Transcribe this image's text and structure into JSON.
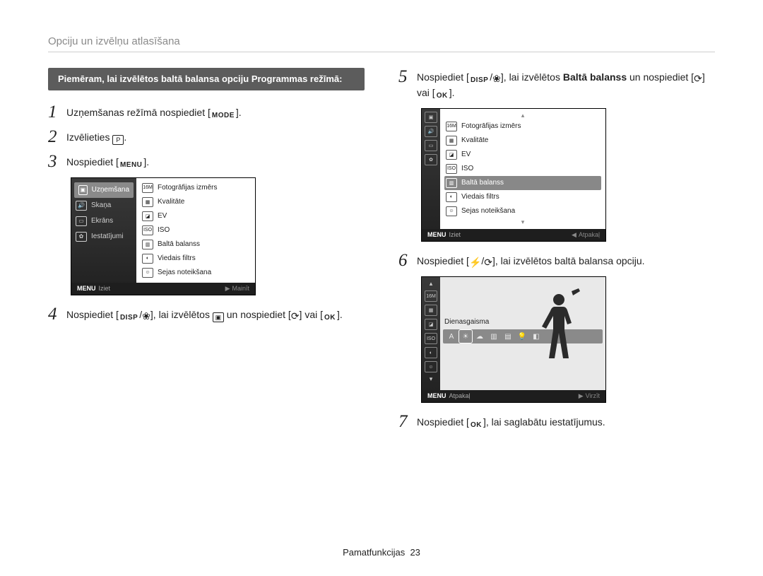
{
  "page_title": "Opciju un izvēlņu atlasīšana",
  "banner": "Piemēram, lai izvēlētos baltā balansa opciju Programmas režīmā:",
  "buttons": {
    "mode": "MODE",
    "menu": "MENU",
    "disp": "DISP",
    "ok": "OK"
  },
  "step_count": 7,
  "steps": {
    "s1": {
      "pre": "Uzņemšanas režīmā nospiediet [",
      "post": "]."
    },
    "s2": {
      "pre": "Izvēlieties ",
      "post": "."
    },
    "s3": {
      "pre": "Nospiediet [",
      "post": "]."
    },
    "s4": {
      "a": "Nospiediet [",
      "b": "], lai izvēlētos ",
      "c": " un nospiediet [",
      "d": "] vai [",
      "e": "]."
    },
    "s5": {
      "a": "Nospiediet [",
      "b": "], lai izvēlētos ",
      "bold": "Baltā balanss",
      "c": " un nospiediet [",
      "d": "] vai [",
      "e": "]."
    },
    "s6": {
      "a": "Nospiediet [",
      "b": "], lai izvēlētos baltā balansa opciju."
    },
    "s7": {
      "a": "Nospiediet [",
      "b": "], lai saglabātu iestatījumus."
    }
  },
  "lcd1": {
    "left": [
      "Uzņemšana",
      "Skaņa",
      "Ekrāns",
      "Iestatījumi"
    ],
    "left_selected": 0,
    "right": [
      "Fotogrāfijas izmērs",
      "Kvalitāte",
      "EV",
      "ISO",
      "Baltā balanss",
      "Viedais filtrs",
      "Sejas noteikšana"
    ],
    "foot_left_label": "MENU",
    "foot_left": "Iziet",
    "foot_right": "Mainīt"
  },
  "lcd2": {
    "right": [
      "Fotogrāfijas izmērs",
      "Kvalitāte",
      "EV",
      "ISO",
      "Baltā balanss",
      "Viedais filtrs",
      "Sejas noteikšana"
    ],
    "selected": 4,
    "foot_left_label": "MENU",
    "foot_left": "Iziet",
    "foot_right": "Atpakaļ"
  },
  "lcd3": {
    "selected_label": "Dienasgaisma",
    "foot_left_label": "MENU",
    "foot_left": "Atpakaļ",
    "foot_right": "Virzīt"
  },
  "footer": {
    "section": "Pamatfunkcijas",
    "page": "23"
  }
}
